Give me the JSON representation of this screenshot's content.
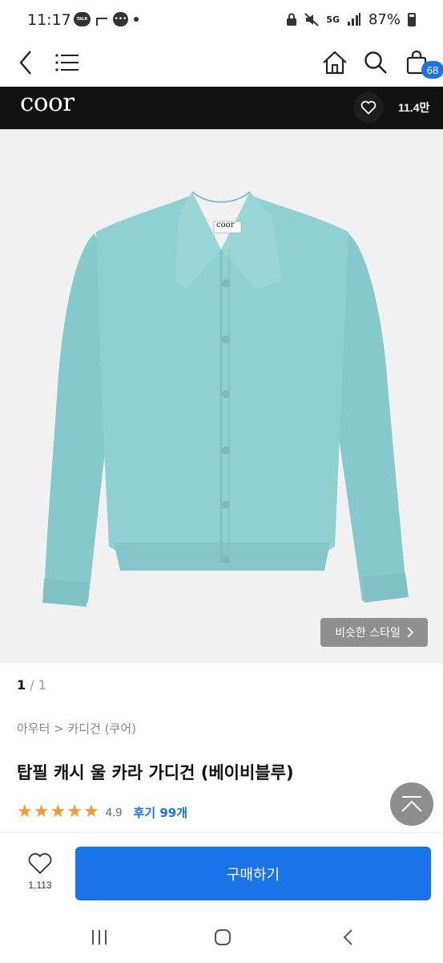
{
  "status_bar": {
    "time": "11:17",
    "battery": "87%",
    "talk_label": "TALK",
    "network_label": "5G"
  },
  "nav": {
    "cart_count": "68"
  },
  "brand": {
    "name": "coor",
    "like_count": "11.4만"
  },
  "product_image": {
    "label_tag": "coor",
    "similar_style_label": "비슷한 스타일"
  },
  "pager": {
    "current": "1",
    "separator": " / ",
    "total": "1"
  },
  "breadcrumb": "아우터 > 카디건 (쿠어)",
  "product": {
    "title": "탑필 캐시 울 카라 가디건 (베이비블루)",
    "rating": "4.9",
    "stars": 5,
    "review_label": "후기 99개"
  },
  "action_bar": {
    "like_count": "1,113",
    "buy_label": "구매하기"
  },
  "colors": {
    "accent": "#1a73e8",
    "star": "#f39a32",
    "cardigan": "#8fd0d2"
  }
}
